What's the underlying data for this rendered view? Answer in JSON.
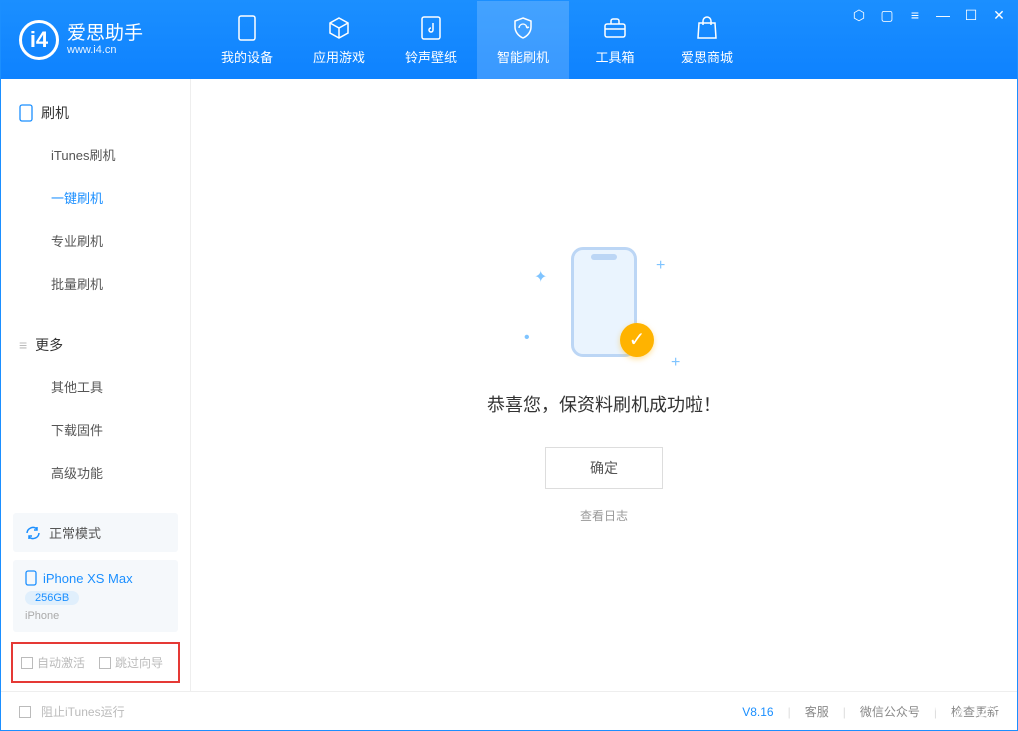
{
  "app": {
    "title": "爱思助手",
    "subtitle": "www.i4.cn"
  },
  "nav": {
    "my_device": "我的设备",
    "apps_games": "应用游戏",
    "ringtones": "铃声壁纸",
    "smart_flash": "智能刷机",
    "toolbox": "工具箱",
    "store": "爱思商城"
  },
  "sidebar": {
    "flash_header": "刷机",
    "items": {
      "itunes": "iTunes刷机",
      "oneclick": "一键刷机",
      "pro": "专业刷机",
      "batch": "批量刷机"
    },
    "more_header": "更多",
    "more": {
      "other_tools": "其他工具",
      "download_firmware": "下载固件",
      "advanced": "高级功能"
    },
    "mode": "正常模式",
    "device": {
      "name": "iPhone XS Max",
      "storage": "256GB",
      "type": "iPhone"
    },
    "checks": {
      "auto_activate": "自动激活",
      "skip_guide": "跳过向导"
    }
  },
  "main": {
    "message": "恭喜您，保资料刷机成功啦！",
    "confirm": "确定",
    "view_log": "查看日志"
  },
  "footer": {
    "block_itunes": "阻止iTunes运行",
    "version": "V8.16",
    "customer_service": "客服",
    "wechat": "微信公众号",
    "check_update": "检查更新"
  }
}
